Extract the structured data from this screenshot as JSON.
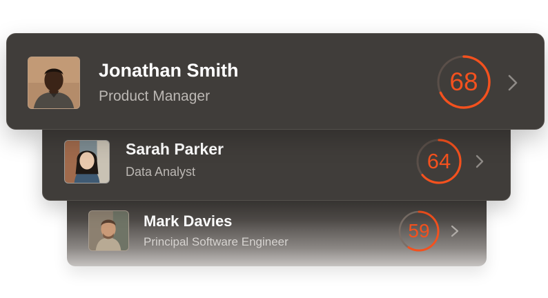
{
  "colors": {
    "card_background": "#403d3a",
    "score_accent": "#f4511e",
    "ring_track": "#5a4f49",
    "name_text": "#ffffff",
    "role_text": "#bcb8b4"
  },
  "people": [
    {
      "name": "Jonathan Smith",
      "role": "Product Manager",
      "score": "68",
      "score_value": 68,
      "avatar_icon": "avatar-photo",
      "chevron_icon": "chevron-right-icon"
    },
    {
      "name": "Sarah Parker",
      "role": "Data Analyst",
      "score": "64",
      "score_value": 64,
      "avatar_icon": "avatar-photo",
      "chevron_icon": "chevron-right-icon"
    },
    {
      "name": "Mark Davies",
      "role": "Principal Software Engineer",
      "score": "59",
      "score_value": 59,
      "avatar_icon": "avatar-photo",
      "chevron_icon": "chevron-right-icon"
    }
  ]
}
